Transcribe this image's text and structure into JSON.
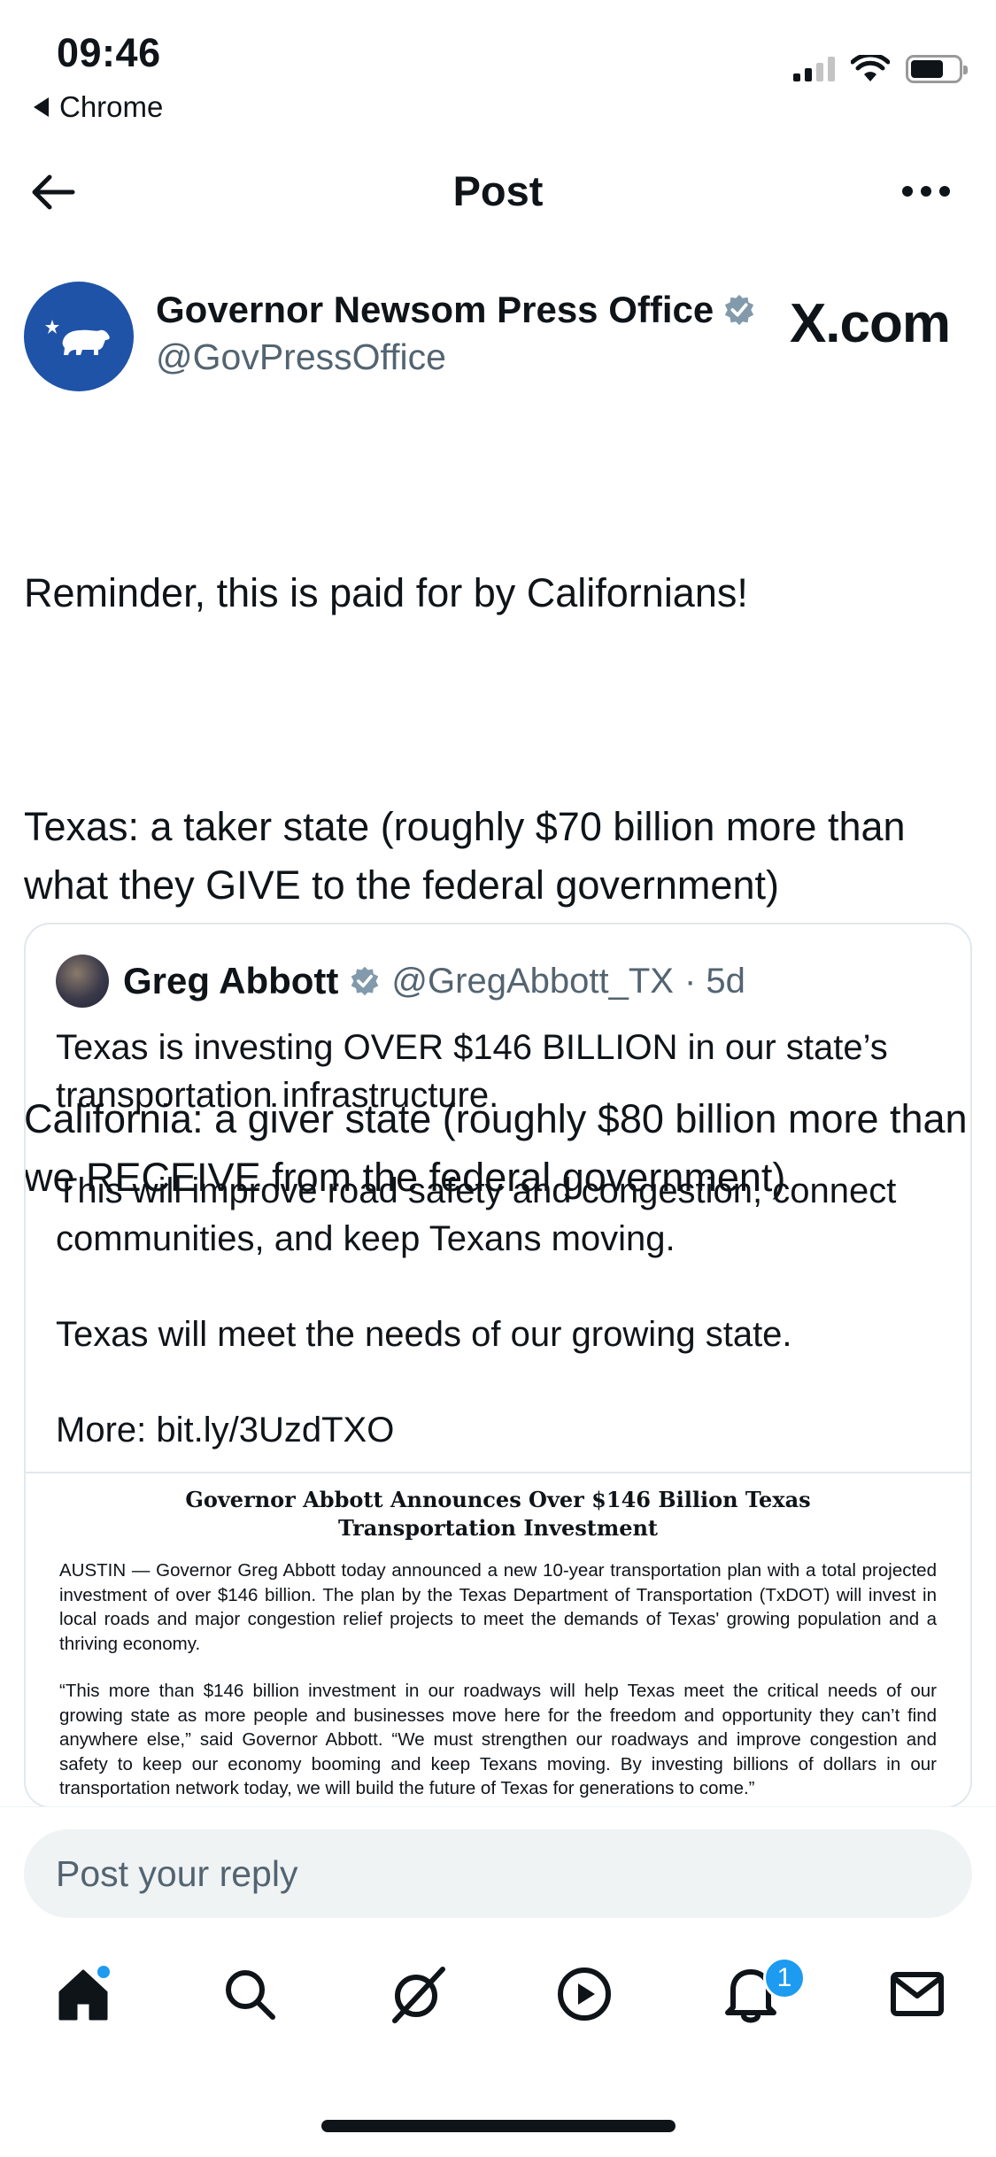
{
  "status_bar": {
    "time": "09:46",
    "back_app": "Chrome"
  },
  "header": {
    "title": "Post"
  },
  "post": {
    "author_name": "Governor Newsom Press Office",
    "author_handle": "@GovPressOffice",
    "watermark": "X.com",
    "paragraphs": [
      "Reminder, this is paid for by Californians!",
      "Texas: a taker state (roughly $70 billion more than what they GIVE to the federal government)",
      "California: a giver state (roughly $80 billion more than we RECEIVE from the federal government)"
    ]
  },
  "quoted_post": {
    "author_name": "Greg Abbott",
    "author_handle": "@GregAbbott_TX",
    "age": "· 5d",
    "paragraphs": [
      "Texas is investing OVER $146 BILLION in our state’s transportation infrastructure.",
      "This will improve road safety and congestion, connect communities, and keep Texans moving.",
      "Texas will meet the needs of our growing state.",
      "More: bit.ly/3UzdTXO"
    ],
    "document": {
      "title": "Governor Abbott Announces Over $146 Billion Texas Transportation Investment",
      "para1": "AUSTIN — Governor Greg Abbott today announced a new 10-year transportation plan with a total projected investment of over $146 billion. The plan by the Texas Department of Transportation (TxDOT) will invest in local roads and major congestion relief projects to meet the demands of Texas' growing population and a thriving economy.",
      "para2": "“This more than $146 billion investment in our roadways will help Texas meet the critical needs of our growing state as more people and businesses move here for the freedom and opportunity they can’t find anywhere else,” said Governor Abbott. “We must strengthen our roadways and improve congestion and safety to keep our economy booming and keep Texans moving. By investing billions of dollars in our transportation network today, we will build the future of Texas for generations to come.”"
    }
  },
  "reply": {
    "placeholder": "Post your reply"
  },
  "tabbar": {
    "items": [
      "home-icon",
      "search-icon",
      "grok-icon",
      "video-icon",
      "notifications-icon",
      "messages-icon"
    ],
    "notification_count": "1",
    "accent": "#1d9bf0"
  }
}
